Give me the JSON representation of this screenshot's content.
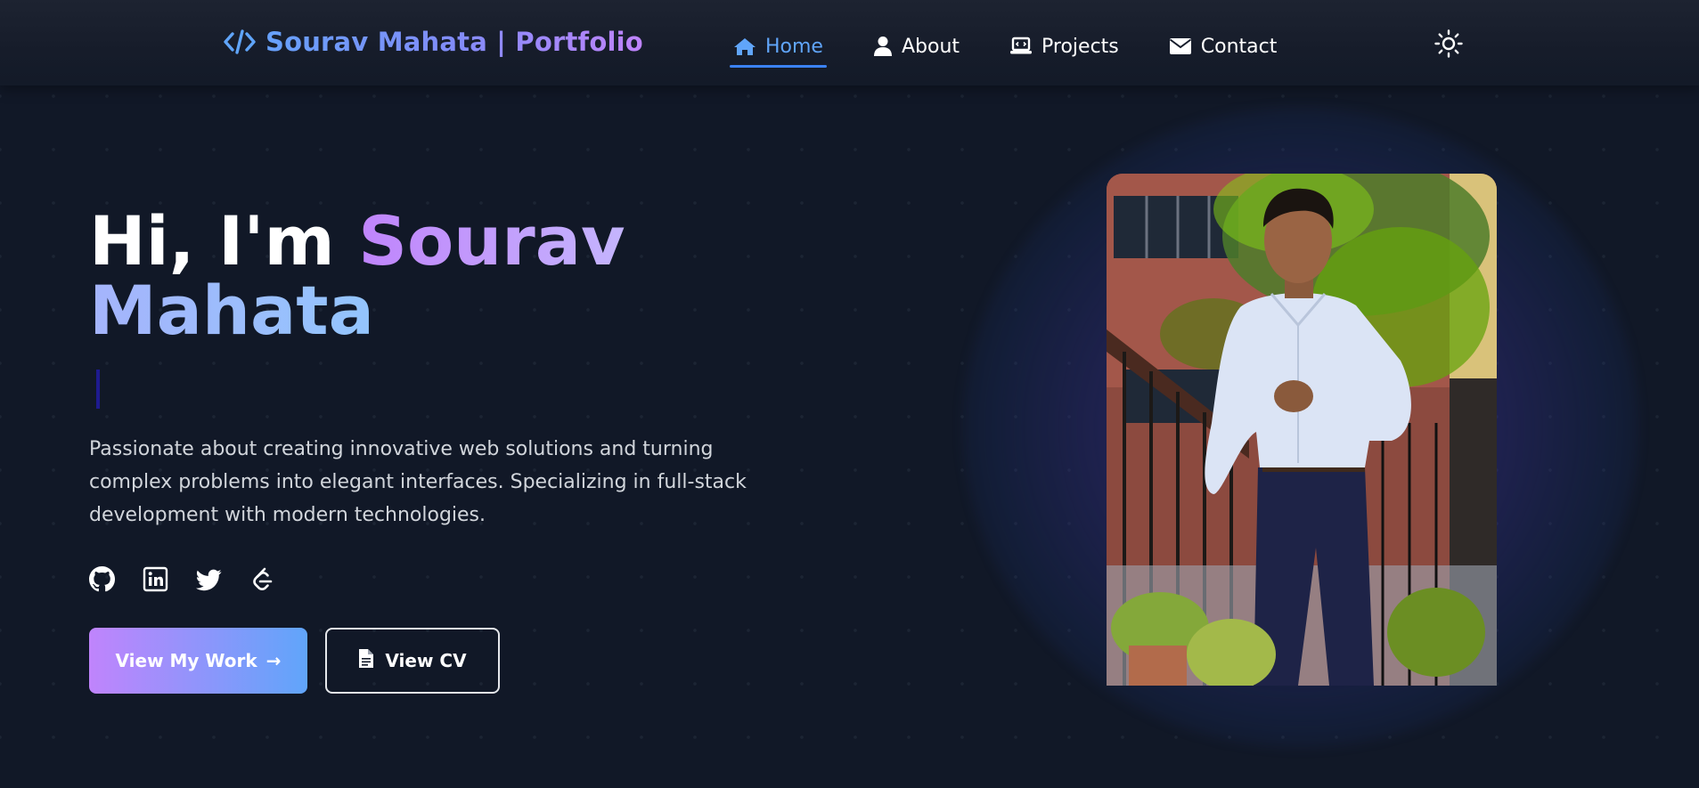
{
  "navbar": {
    "brand_text": "Sourav Mahata | Portfolio",
    "brand_icon": "code-icon",
    "links": [
      {
        "label": "Home",
        "icon": "home-icon",
        "active": true
      },
      {
        "label": "About",
        "icon": "user-icon",
        "active": false
      },
      {
        "label": "Projects",
        "icon": "laptop-code-icon",
        "active": false
      },
      {
        "label": "Contact",
        "icon": "envelope-icon",
        "active": false
      }
    ],
    "theme_toggle_icon": "sun-icon"
  },
  "hero": {
    "greeting": "Hi, I'm",
    "first_name": "Sourav",
    "last_name": "Mahata",
    "description": "Passionate about creating innovative web solutions and turning complex problems into elegant interfaces. Specializing in full-stack development with modern technologies.",
    "socials": [
      {
        "icon": "github-icon"
      },
      {
        "icon": "linkedin-icon"
      },
      {
        "icon": "twitter-icon"
      },
      {
        "icon": "leetcode-icon"
      }
    ],
    "primary_button": {
      "label": "View My Work",
      "arrow": "→"
    },
    "secondary_button": {
      "label": "View CV",
      "icon": "file-icon"
    }
  },
  "colors": {
    "background": "#111827",
    "accent_blue": "#60a5fa",
    "accent_purple": "#c084fc",
    "text_muted": "#d1d5db"
  }
}
